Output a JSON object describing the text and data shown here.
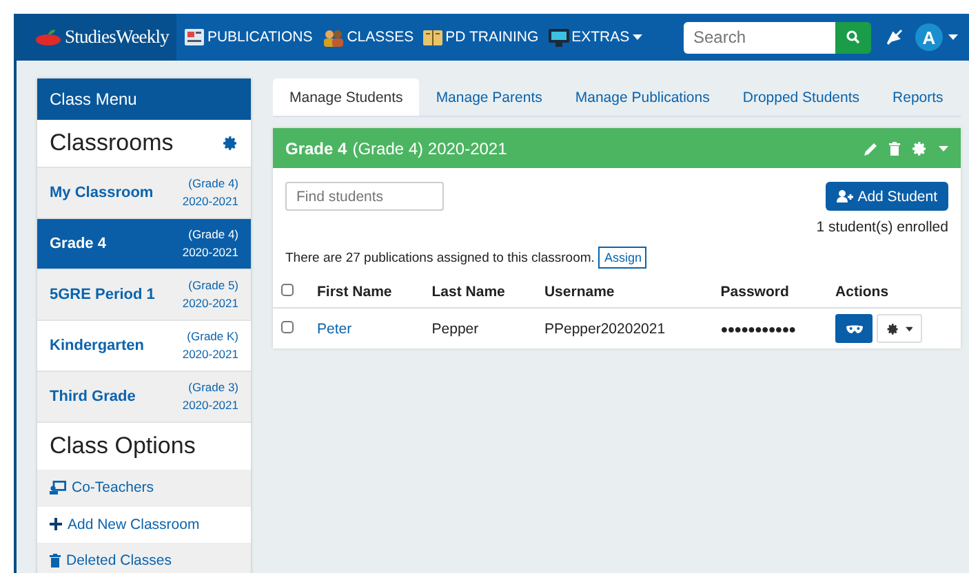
{
  "navbar": {
    "logo": "StudiesWeekly",
    "items": [
      {
        "label": "PUBLICATIONS",
        "kind": "link"
      },
      {
        "label": "CLASSES",
        "kind": "link"
      },
      {
        "label": "PD TRAINING",
        "kind": "link"
      },
      {
        "label": "EXTRAS",
        "kind": "dropdown"
      }
    ],
    "search": {
      "placeholder": "Search"
    },
    "avatar": "A"
  },
  "sidebar": {
    "header": "Class Menu",
    "classrooms_title": "Classrooms",
    "classrooms": [
      {
        "name": "My Classroom",
        "grade": "(Grade 4)",
        "year": "2020-2021",
        "selected": false
      },
      {
        "name": "Grade 4",
        "grade": "(Grade 4)",
        "year": "2020-2021",
        "selected": true
      },
      {
        "name": "5GRE Period 1",
        "grade": "(Grade 5)",
        "year": "2020-2021",
        "selected": false
      },
      {
        "name": "Kindergarten",
        "grade": "(Grade K)",
        "year": "2020-2021",
        "selected": false
      },
      {
        "name": "Third Grade",
        "grade": "(Grade 3)",
        "year": "2020-2021",
        "selected": false
      }
    ],
    "options_title": "Class Options",
    "options": [
      {
        "label": "Co-Teachers",
        "kind": "teacher"
      },
      {
        "label": "Add New Classroom",
        "kind": "add"
      },
      {
        "label": "Deleted Classes",
        "kind": "trash"
      }
    ]
  },
  "tabs": [
    {
      "label": "Manage Students",
      "selected": true
    },
    {
      "label": "Manage Parents",
      "selected": false
    },
    {
      "label": "Manage Publications",
      "selected": false
    },
    {
      "label": "Dropped Students",
      "selected": false
    },
    {
      "label": "Reports",
      "selected": false
    }
  ],
  "panel": {
    "class_name": "Grade 4",
    "class_detail": "(Grade 4) 2020-2021",
    "search": {
      "placeholder": "Find students"
    },
    "add_button": "Add Student",
    "enrolled": "1 student(s) enrolled",
    "publications_note": "There are 27 publications assigned to this classroom.",
    "assign_button": "Assign",
    "table": {
      "columns": [
        "First Name",
        "Last Name",
        "Username",
        "Password",
        "Actions"
      ],
      "select_all_checked": false,
      "rows": [
        {
          "first_name": "Peter",
          "last_name": "Pepper",
          "username": "PPepper20202021",
          "password": "●●●●●●●●●●●",
          "checked": false
        }
      ]
    }
  }
}
